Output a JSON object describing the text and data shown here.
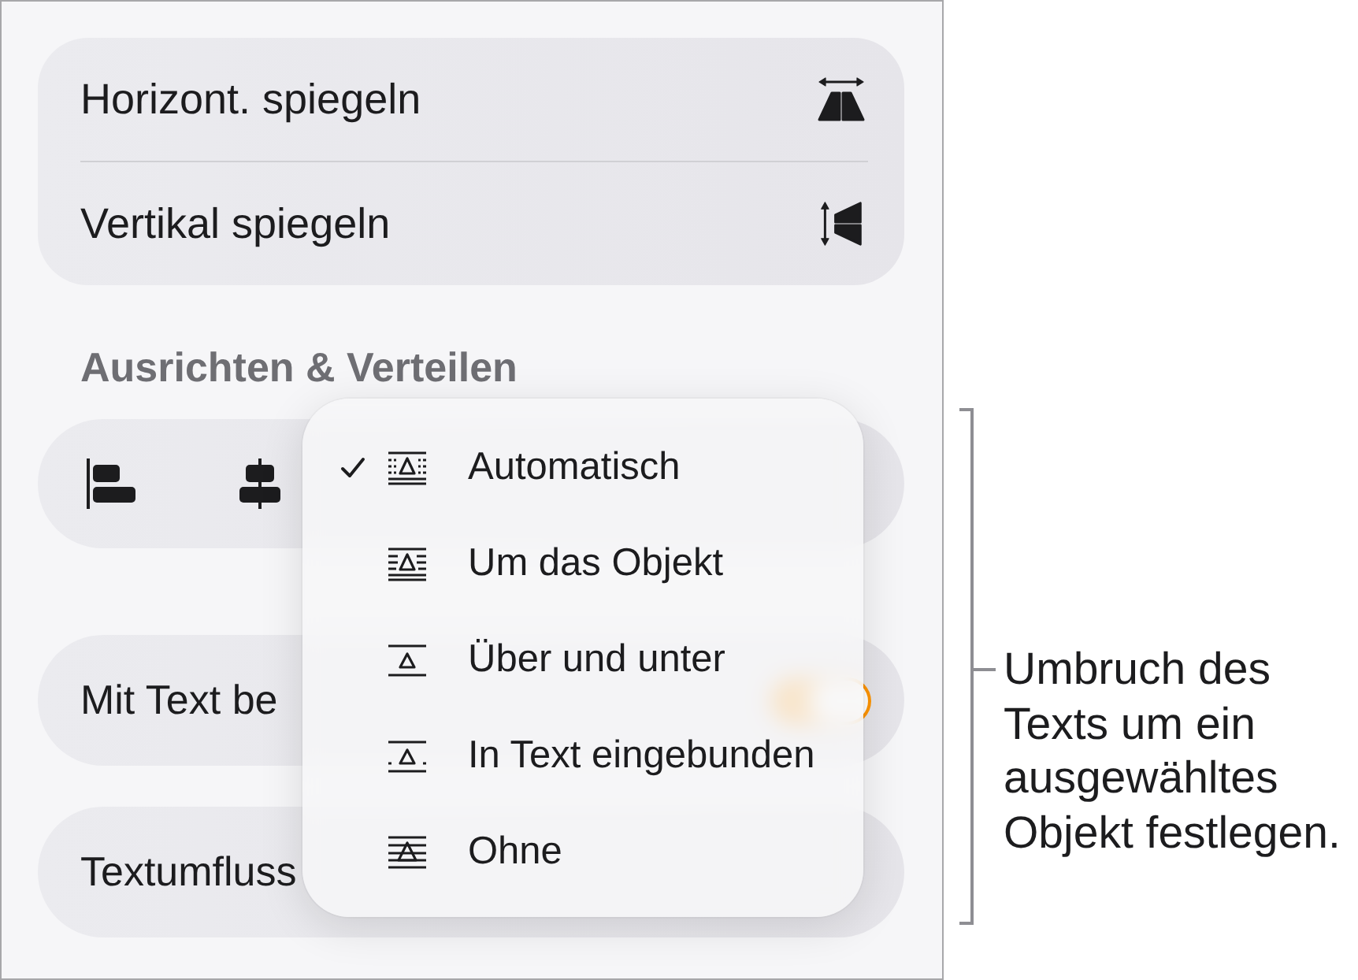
{
  "flip_card": {
    "items": [
      {
        "label": "Horizont. spiegeln",
        "kind": "horizontal"
      },
      {
        "label": "Vertikal spiegeln",
        "kind": "vertical"
      }
    ]
  },
  "align_section": {
    "title": "Ausrichten & Verteilen"
  },
  "move_with_text": {
    "label": "Mit Text be",
    "on": true
  },
  "text_wrap": {
    "label": "Textumfluss"
  },
  "wrap_menu": {
    "items": [
      {
        "label": "Automatisch",
        "kind": "auto",
        "selected": true
      },
      {
        "label": "Um das Objekt",
        "kind": "around",
        "selected": false
      },
      {
        "label": "Über und unter",
        "kind": "top-bottom",
        "selected": false
      },
      {
        "label": "In Text eingebunden",
        "kind": "inline",
        "selected": false
      },
      {
        "label": "Ohne",
        "kind": "none",
        "selected": false
      }
    ]
  },
  "callout": {
    "text": "Umbruch des Texts um ein ausgewähltes Objekt festlegen."
  }
}
